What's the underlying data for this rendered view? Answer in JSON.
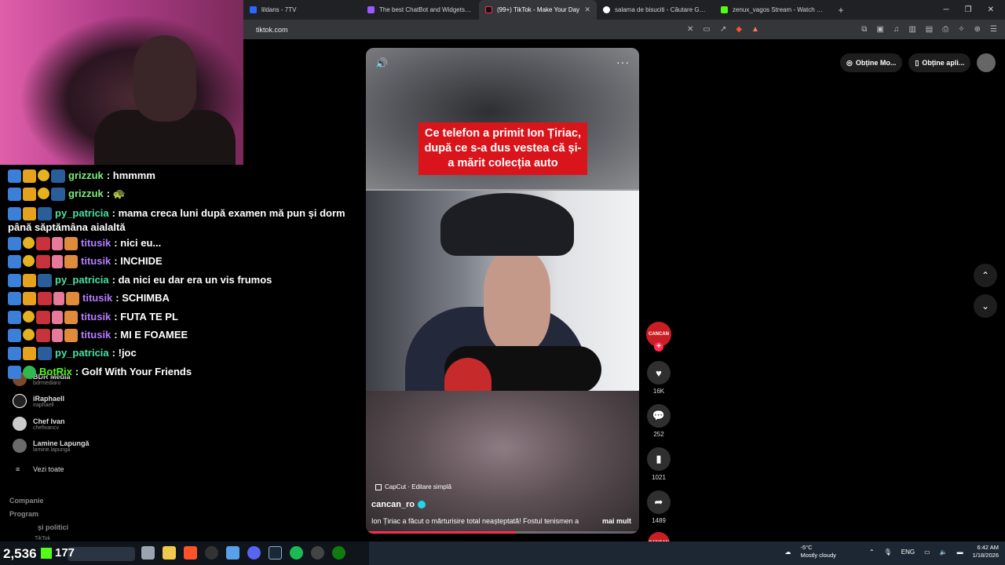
{
  "browser": {
    "tabs": [
      {
        "title": "lildans - 7TV",
        "icon_color": "#2b66ff",
        "active": false
      },
      {
        "title": "The best ChatBot and Widgets for Ki",
        "icon_color": "#9b59ff",
        "active": false
      },
      {
        "title": "(99+) TikTok - Make Your Day",
        "icon_color": "#000000",
        "active": true
      },
      {
        "title": "salama de bisuciti - Căutare Google",
        "icon_color": "#4285f4",
        "active": false
      },
      {
        "title": "zenux_vagos Stream - Watch Live on",
        "icon_color": "#53fc18",
        "active": false
      }
    ],
    "url": "tiktok.com"
  },
  "chat": [
    {
      "user": "grizzuk",
      "text": "hmmmm",
      "color": "#7cf07c"
    },
    {
      "user": "grizzuk",
      "text": "🐢",
      "color": "#7cf07c"
    },
    {
      "user": "py_patricia",
      "text": "mama creca luni după examen mă pun și dorm până săptămâna aialaltă",
      "color": "#4be1a3"
    },
    {
      "user": "titusik",
      "text": "nici eu...",
      "color": "#b57cff"
    },
    {
      "user": "titusik",
      "text": "INCHIDE",
      "color": "#b57cff"
    },
    {
      "user": "py_patricia",
      "text": "da nici eu dar era un vis frumos",
      "color": "#4be1a3"
    },
    {
      "user": "titusik",
      "text": "SCHIMBA",
      "color": "#b57cff"
    },
    {
      "user": "titusik",
      "text": "FUTA TE PL",
      "color": "#b57cff"
    },
    {
      "user": "titusik",
      "text": "MI E FOAMEE",
      "color": "#b57cff"
    },
    {
      "user": "py_patricia",
      "text": "!joc",
      "color": "#4be1a3"
    },
    {
      "user": "BotRix",
      "text": "Golf With Your Friends",
      "color": "#53fc18"
    }
  ],
  "sidebar": {
    "accounts": [
      {
        "name": "BDR Media",
        "handle": "bdrmediaro"
      },
      {
        "name": "iRaphaell",
        "handle": "iraphaell"
      },
      {
        "name": "Chef Ivan",
        "handle": "chefivancv"
      },
      {
        "name": "Lamine Lapungă",
        "handle": "lamine.lapunga"
      }
    ],
    "see_all": "Vezi toate",
    "company": "Companie",
    "program": "Program",
    "policies": "și politici",
    "tiktok": "TikTok"
  },
  "video": {
    "headline": "Ce telefon a primit Ion Țiriac, după ce s-a dus vestea că și-a mărit colecția auto",
    "capcut": "CapCut · Editare simplă",
    "author": "cancan_ro",
    "description": "Ion Țiriac a făcut o mărturisire total neașteptată! Fostul tenismen a",
    "more": "mai mult",
    "progress": 0.55
  },
  "actions": {
    "avatar": "CANCAN",
    "likes": "16K",
    "comments": "252",
    "saves": "1021",
    "shares": "1489"
  },
  "right": {
    "get_coins": "Obține Mo...",
    "get_app": "Obține apli..."
  },
  "overlay": {
    "viewers": "2,536",
    "kick_count": "177"
  },
  "tray": {
    "temp": "-5°C",
    "weather": "Mostly cloudy",
    "lang": "ENG",
    "time": "6:42 AM",
    "date": "1/18/2026"
  }
}
